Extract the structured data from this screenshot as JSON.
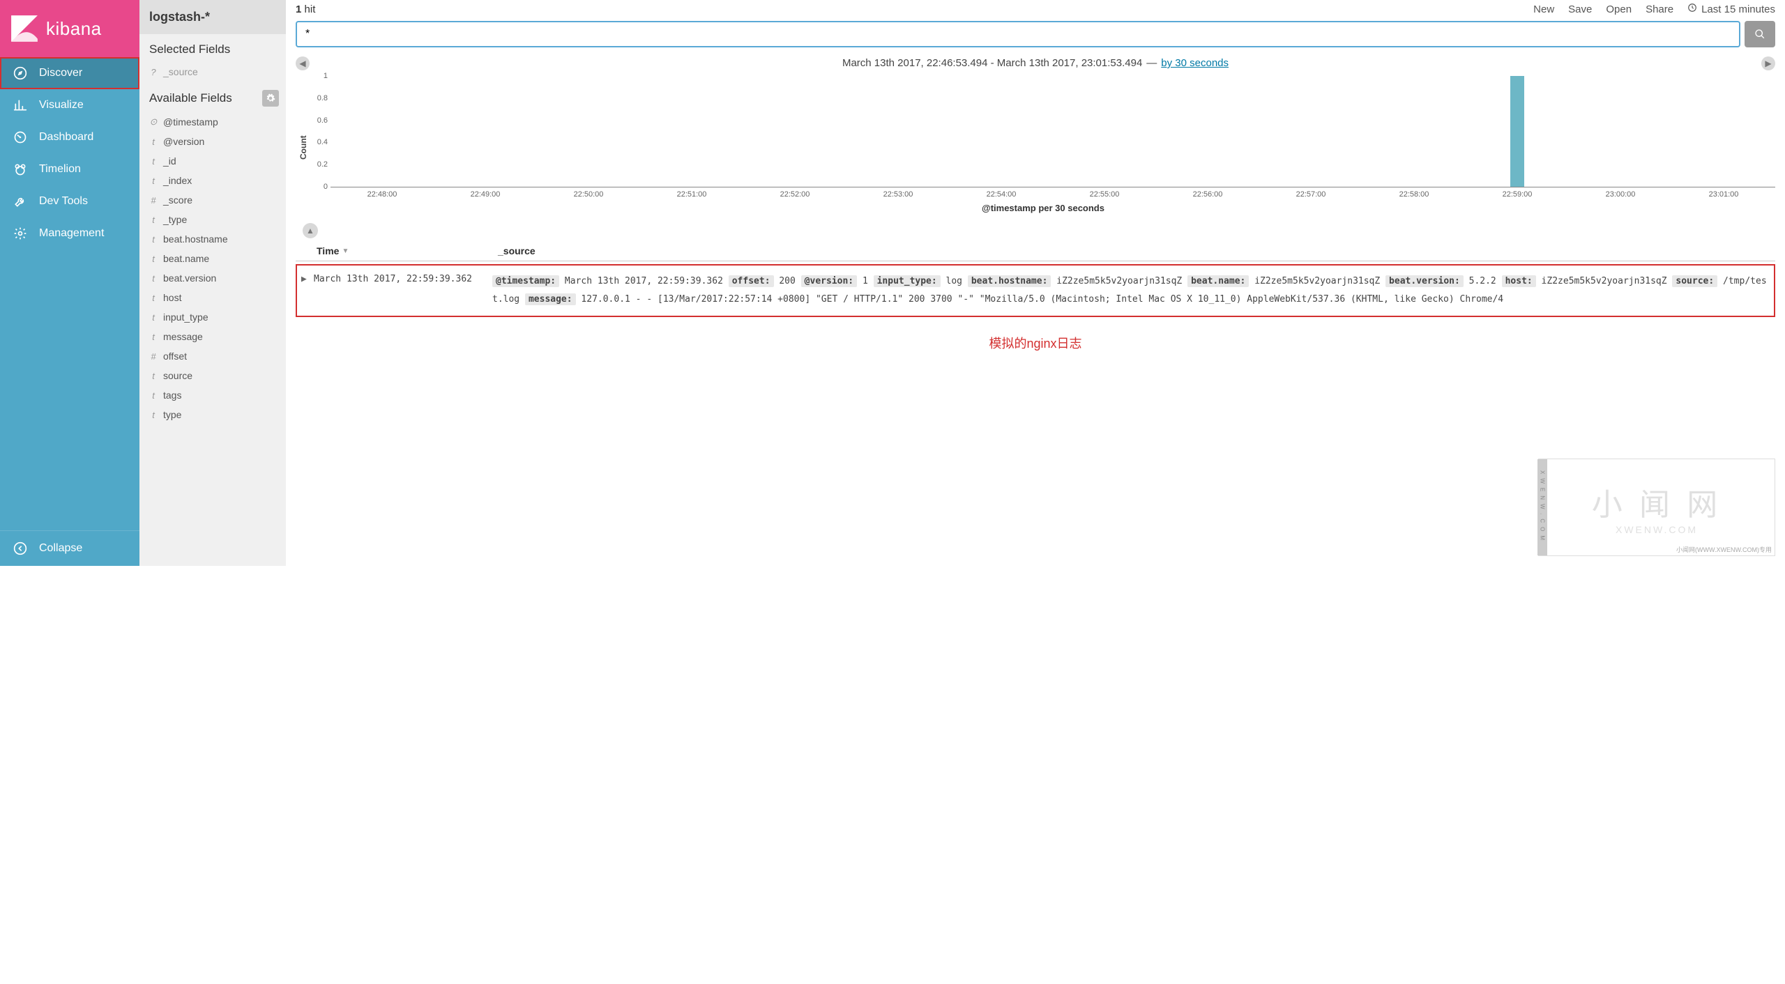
{
  "brand": "kibana",
  "nav": {
    "items": [
      {
        "label": "Discover",
        "icon": "compass",
        "active": true
      },
      {
        "label": "Visualize",
        "icon": "bar-chart",
        "active": false
      },
      {
        "label": "Dashboard",
        "icon": "gauge",
        "active": false
      },
      {
        "label": "Timelion",
        "icon": "bear",
        "active": false
      },
      {
        "label": "Dev Tools",
        "icon": "wrench",
        "active": false
      },
      {
        "label": "Management",
        "icon": "gear",
        "active": false
      }
    ],
    "collapse": "Collapse"
  },
  "fields": {
    "index_pattern": "logstash-*",
    "selected_title": "Selected Fields",
    "selected": [
      {
        "type": "?",
        "name": "_source"
      }
    ],
    "available_title": "Available Fields",
    "available": [
      {
        "type": "⊙",
        "name": "@timestamp"
      },
      {
        "type": "t",
        "name": "@version"
      },
      {
        "type": "t",
        "name": "_id"
      },
      {
        "type": "t",
        "name": "_index"
      },
      {
        "type": "#",
        "name": "_score"
      },
      {
        "type": "t",
        "name": "_type"
      },
      {
        "type": "t",
        "name": "beat.hostname"
      },
      {
        "type": "t",
        "name": "beat.name"
      },
      {
        "type": "t",
        "name": "beat.version"
      },
      {
        "type": "t",
        "name": "host"
      },
      {
        "type": "t",
        "name": "input_type"
      },
      {
        "type": "t",
        "name": "message"
      },
      {
        "type": "#",
        "name": "offset"
      },
      {
        "type": "t",
        "name": "source"
      },
      {
        "type": "t",
        "name": "tags"
      },
      {
        "type": "t",
        "name": "type"
      }
    ]
  },
  "topbar": {
    "hit_count": "1",
    "hit_label": "hit",
    "actions": [
      "New",
      "Save",
      "Open",
      "Share"
    ],
    "timefilter": "Last 15 minutes"
  },
  "search": {
    "value": "*",
    "placeholder": ""
  },
  "timeline": {
    "range": "March 13th 2017, 22:46:53.494 - March 13th 2017, 23:01:53.494",
    "dash": "—",
    "interval": "by 30 seconds"
  },
  "chart_data": {
    "type": "bar",
    "ylabel": "Count",
    "xlabel": "@timestamp per 30 seconds",
    "ylim": [
      0,
      1
    ],
    "yticks": [
      "1",
      "0.8",
      "0.6",
      "0.4",
      "0.2",
      "0"
    ],
    "categories": [
      "22:48:00",
      "22:49:00",
      "22:50:00",
      "22:51:00",
      "22:52:00",
      "22:53:00",
      "22:54:00",
      "22:55:00",
      "22:56:00",
      "22:57:00",
      "22:58:00",
      "22:59:00",
      "23:00:00",
      "23:01:00"
    ],
    "values": [
      0,
      0,
      0,
      0,
      0,
      0,
      0,
      0,
      0,
      0,
      0,
      1,
      0,
      0
    ]
  },
  "table": {
    "col_time": "Time",
    "col_source": "_source",
    "row": {
      "time": "March 13th 2017, 22:59:39.362",
      "kv": [
        {
          "k": "@timestamp:",
          "v": "March 13th 2017, 22:59:39.362"
        },
        {
          "k": "offset:",
          "v": "200"
        },
        {
          "k": "@version:",
          "v": "1"
        },
        {
          "k": "input_type:",
          "v": "log"
        },
        {
          "k": "beat.hostname:",
          "v": "iZ2ze5m5k5v2yoarjn31sqZ"
        },
        {
          "k": "beat.name:",
          "v": "iZ2ze5m5k5v2yoarjn31sqZ"
        },
        {
          "k": "beat.version:",
          "v": "5.2.2"
        },
        {
          "k": "host:",
          "v": "iZ2ze5m5k5v2yoarjn31sqZ"
        },
        {
          "k": "source:",
          "v": "/tmp/test.log"
        },
        {
          "k": "message:",
          "v": "127.0.0.1 - - [13/Mar/2017:22:57:14 +0800] \"GET / HTTP/1.1\" 200 3700 \"-\" \"Mozilla/5.0 (Macintosh; Intel Mac OS X 10_11_0) AppleWebKit/537.36 (KHTML, like Gecko) Chrome/4"
        }
      ]
    }
  },
  "annotation": "模拟的nginx日志",
  "watermark": {
    "main": "小 闻 网",
    "sub": "XWENW.COM",
    "side": "XWENW.COM",
    "foot": "小闻网(WWW.XWENW.COM)专用"
  }
}
